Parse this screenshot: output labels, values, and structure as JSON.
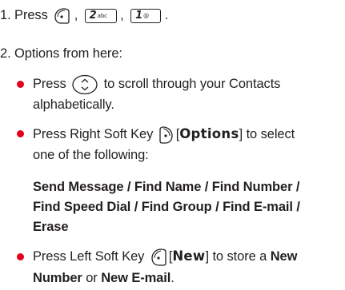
{
  "step1": {
    "number": "1.",
    "text": "Press",
    "sep1": ",",
    "sep2": ",",
    "end": ".",
    "key2": {
      "digit": "2",
      "letters": "abc"
    },
    "key1": {
      "digit": "1",
      "letters": "@"
    }
  },
  "step2": {
    "number": "2.",
    "text": "Options from here:"
  },
  "bullet1": {
    "pre": "Press",
    "post_line1": "to scroll through your Contacts",
    "line2": "alphabetically."
  },
  "bullet2": {
    "pre": "Press Right Soft Key",
    "bracket_open": "[",
    "key_label": "Options",
    "bracket_close": "]",
    "post_line1": "to select",
    "line2": "one of the following:"
  },
  "options_list": {
    "line1": "Send Message / Find Name / Find Number /",
    "line2": "Find Speed Dial / Find Group / Find E-mail /",
    "line3": "Erase"
  },
  "bullet3": {
    "pre": "Press Left Soft Key",
    "bracket_open": "[",
    "key_label": "New",
    "bracket_close": "]",
    "mid": "to store a",
    "new_number_bold": "New",
    "line2_bold": "Number",
    "line2_mid": "or",
    "line2_bold2": "New E-mail",
    "line2_end": "."
  },
  "colors": {
    "text": "#231f20",
    "bullet": "#e2001a"
  }
}
